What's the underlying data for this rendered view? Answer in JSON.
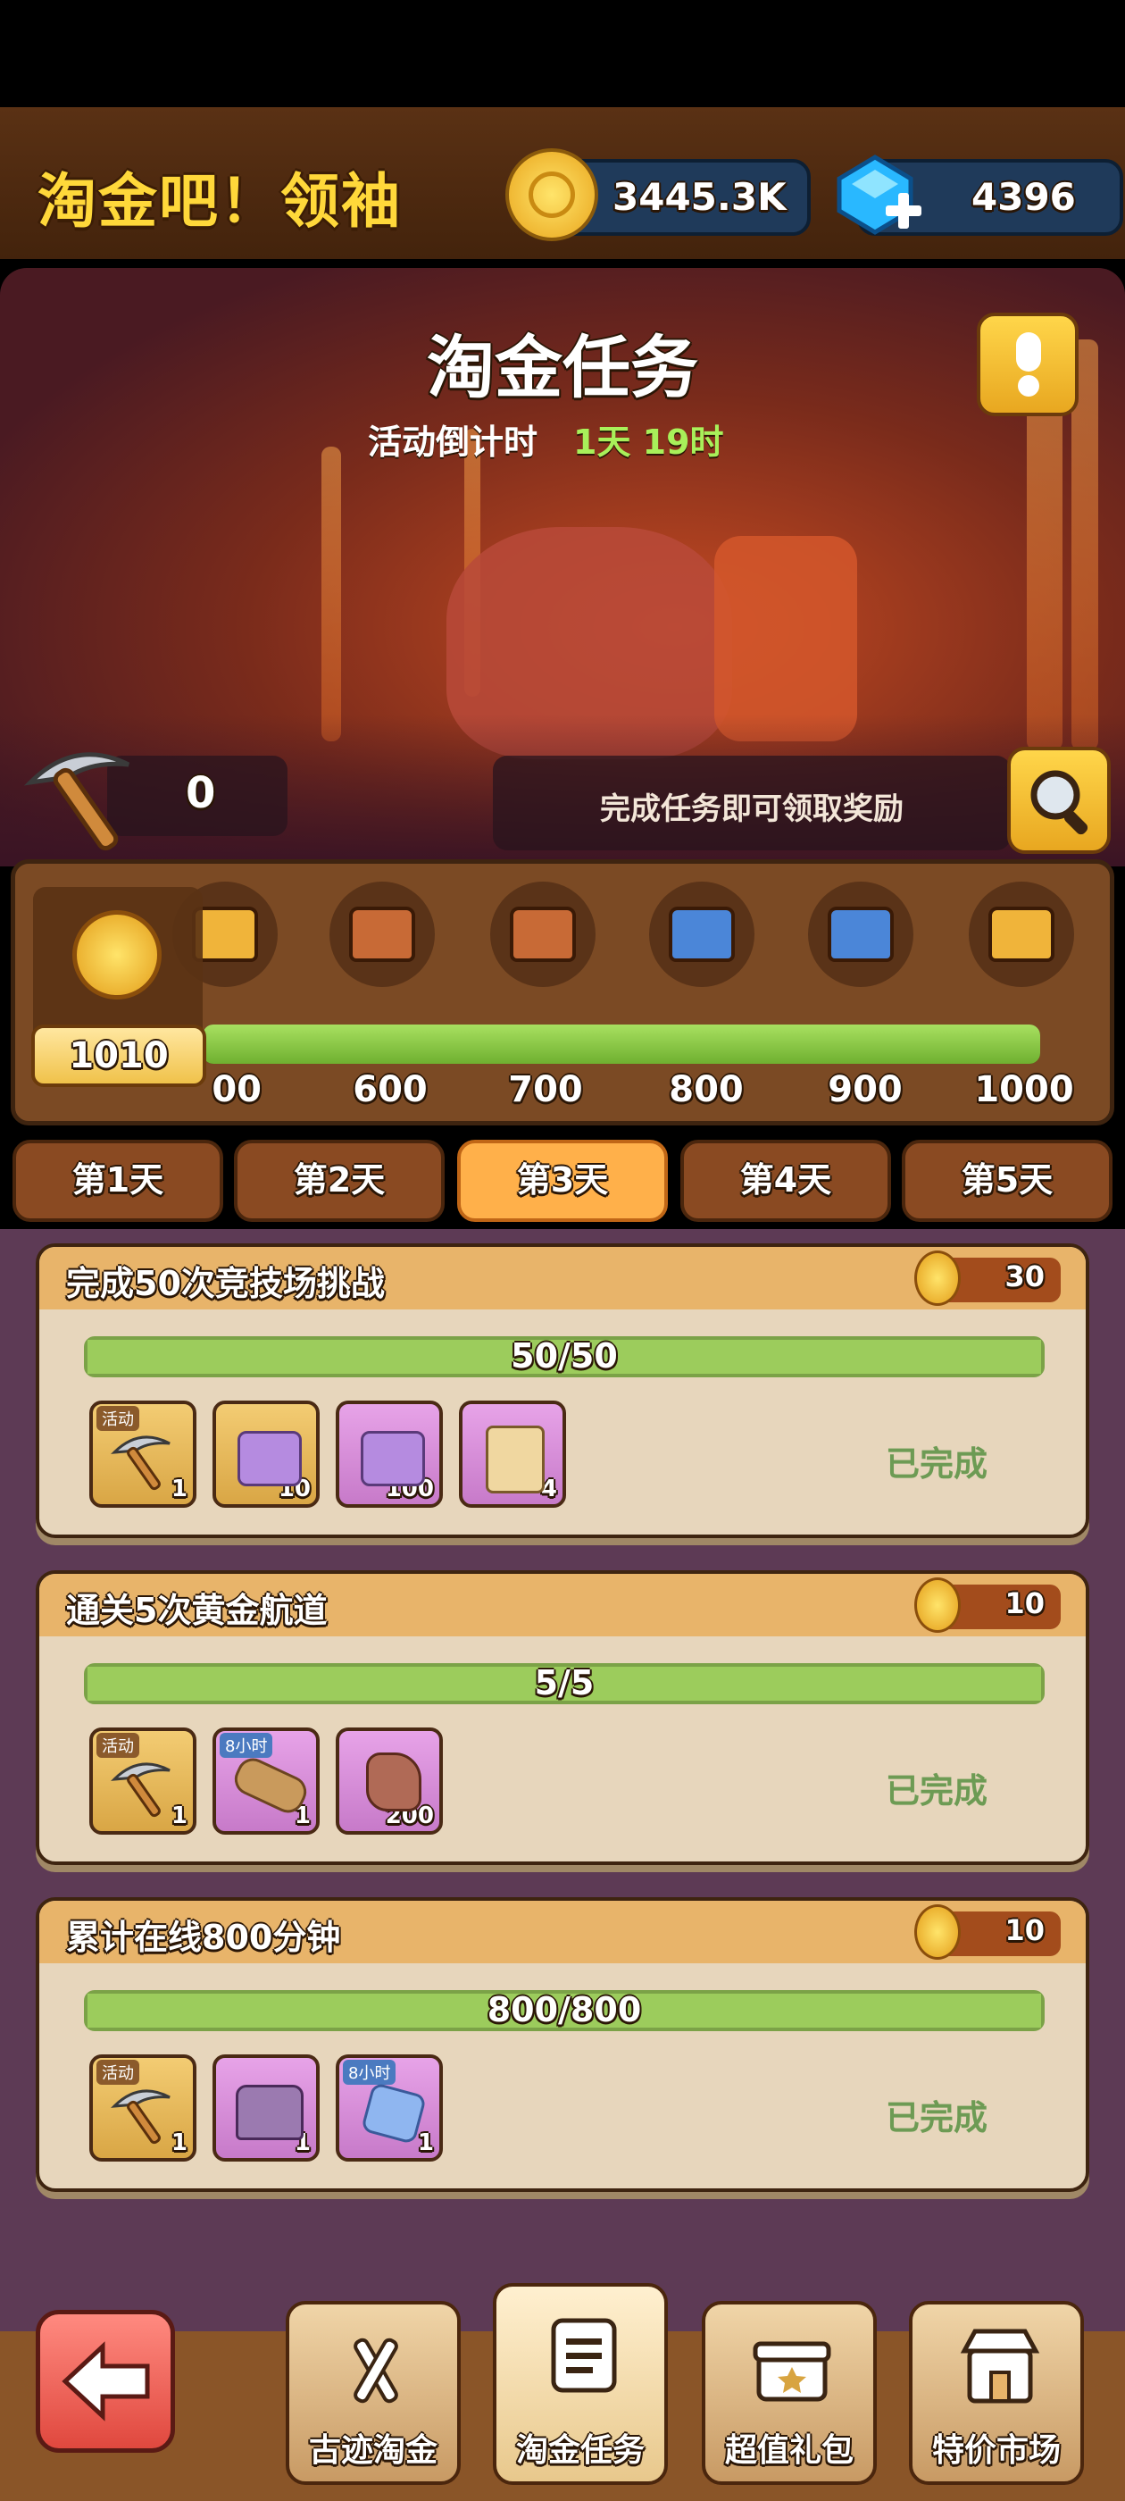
{
  "app_title": "淘金吧！领袖",
  "resources": {
    "gold": "3445.3K",
    "gems": "4396"
  },
  "hero": {
    "title": "淘金任务",
    "countdown_label": "活动倒计时",
    "countdown_value": "1天 19时",
    "pickaxe_count": "0",
    "hint": "完成任务即可领取奖励"
  },
  "milestones": {
    "current_points": "1010",
    "labels": [
      "500",
      "600",
      "700",
      "800",
      "900",
      "1000"
    ],
    "partial_first_label": "00",
    "progress_fraction": 1.0
  },
  "day_tabs": [
    "第1天",
    "第2天",
    "第3天",
    "第4天",
    "第5天"
  ],
  "active_day": "第3天",
  "tasks": [
    {
      "title": "完成50次竞技场挑战",
      "points": "30",
      "progress": "50/50",
      "progress_fraction": 1.0,
      "rewards": [
        {
          "icon": "pickaxe-icon",
          "tag": "活动",
          "count": "1",
          "style": "gold"
        },
        {
          "icon": "purple-shirt-plus-icon",
          "count": "10",
          "style": "gold"
        },
        {
          "icon": "purple-shirt-plus-icon",
          "count": "100",
          "style": "purple"
        },
        {
          "icon": "scroll-icon",
          "count": "4",
          "style": "purple"
        }
      ],
      "status": "已完成"
    },
    {
      "title": "通关5次黄金航道",
      "points": "10",
      "progress": "5/5",
      "progress_fraction": 1.0,
      "rewards": [
        {
          "icon": "pickaxe-icon",
          "tag": "活动",
          "count": "1",
          "style": "gold"
        },
        {
          "icon": "wood-logs-icon",
          "tag": "8小时",
          "count": "1",
          "style": "purple"
        },
        {
          "icon": "ore-icon",
          "count": "200",
          "style": "purple"
        }
      ],
      "status": "已完成"
    },
    {
      "title": "累计在线800分钟",
      "points": "10",
      "progress": "800/800",
      "progress_fraction": 1.0,
      "rewards": [
        {
          "icon": "pickaxe-icon",
          "tag": "活动",
          "count": "1",
          "style": "gold"
        },
        {
          "icon": "treasure-chest-icon",
          "count": "1",
          "style": "purple"
        },
        {
          "icon": "crystal-icon",
          "tag": "8小时",
          "count": "1",
          "style": "purple"
        }
      ],
      "status": "已完成"
    }
  ],
  "bottom_nav": [
    "古迹淘金",
    "淘金任务",
    "超值礼包",
    "特价市场"
  ],
  "colors": {
    "accent_gold": "#ffd83a",
    "countdown_green": "#a8f05a",
    "progress_green": "#9ccc5c",
    "done_green": "#6d9b54",
    "active_tab": "#ffb04a"
  }
}
